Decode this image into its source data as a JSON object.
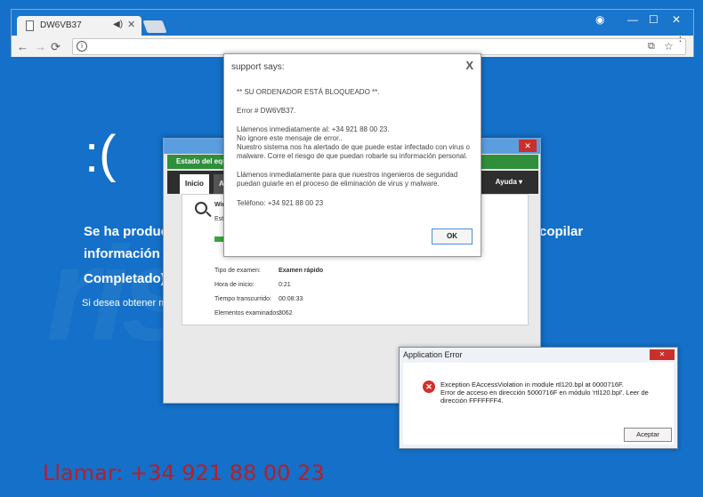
{
  "browser": {
    "tab_title": "DW6VB37",
    "tab_audio_icon": "speaker-icon",
    "tab_close": "✕"
  },
  "page": {
    "sad_face": ":(",
    "line1": "Se ha produc",
    "line1_tail": "copilar",
    "line2": "información e",
    "line3": "Completado)",
    "small": "Si desea obtener más",
    "call_line": "Llamar: +34 921 88 00 23"
  },
  "security_window": {
    "close": "✕",
    "green_bar": "Estado del equi",
    "tab_home": "Inicio",
    "tab_second": "Ac",
    "help": "Ayuda ▾",
    "scan_title": "Win",
    "scan_status": "Esto",
    "rows": [
      {
        "label": "Tipo de examen:",
        "value": "Examen rápido"
      },
      {
        "label": "Hora de inicio:",
        "value": "0:21"
      },
      {
        "label": "Tiempo transcurrido:",
        "value": "00:08:33"
      },
      {
        "label": "Elementos examinados:",
        "value": "3062"
      }
    ]
  },
  "support_dialog": {
    "title": "support says:",
    "close": "X",
    "line_blocked": "** SU ORDENADOR ESTÁ BLOQUEADO **.",
    "error": "Error # DW6VB37.",
    "call_now": "Llámenos inmediatamente al: +34 921 88 00 23.",
    "ignore": "No ignore este mensaje de error..",
    "alert": "Nuestro sistema nos ha alertado de que puede estar infectado con virus o malware. Corre el riesgo de que puedan robarle su información personal.",
    "engineers": "Llámenos inmediatamente para que nuestros ingenieros de seguridad puedan guiarle en el proceso de eliminación de virus y malware.",
    "phone": "Teléfono: +34 921 88 00 23",
    "ok": "OK"
  },
  "app_error": {
    "title": "Application Error",
    "close": "✕",
    "line1": "Exception EAccessViolation in module rtl120.bpl at 0000716F.",
    "line2": "Error de acceso en dirección 5000716F en módulo 'rtl120.bpl'. Leer de dirección FFFFFFF4.",
    "accept": "Aceptar"
  }
}
